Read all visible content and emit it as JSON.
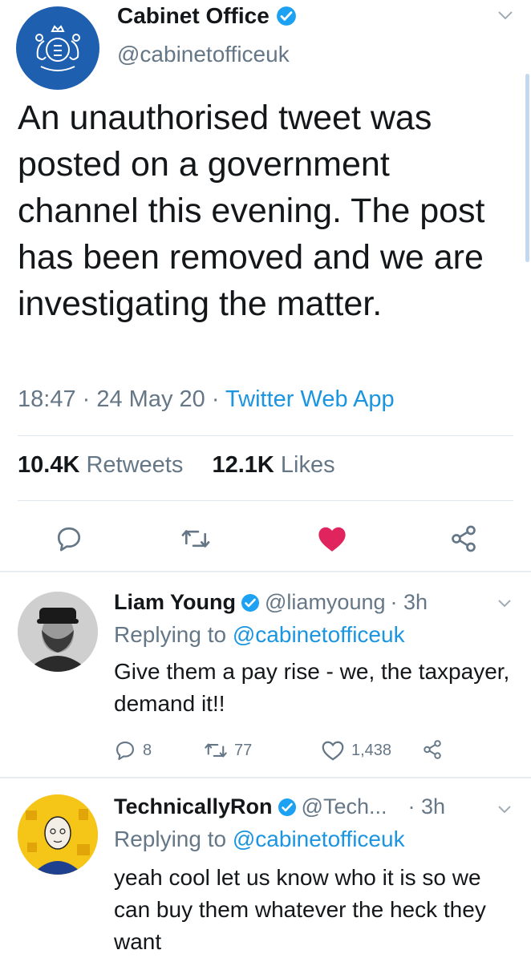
{
  "main": {
    "name": "Cabinet Office",
    "handle": "@cabinetofficeuk",
    "text": "An unauthorised tweet was posted on a government channel this evening. The post has been removed and we are investigating the matter.",
    "time": "18:47",
    "date": "24 May 20",
    "source": "Twitter Web App",
    "retweets_count": "10.4K",
    "retweets_label": "Retweets",
    "likes_count": "12.1K",
    "likes_label": "Likes"
  },
  "replies": [
    {
      "name": "Liam Young",
      "handle": "@liamyoung",
      "time": "· 3h",
      "replying_prefix": "Replying to ",
      "replying_to": "@cabinetofficeuk",
      "text": "Give them a pay rise - we, the taxpayer, demand it!!",
      "reply_count": "8",
      "retweet_count": "77",
      "like_count": "1,438"
    },
    {
      "name": "TechnicallyRon",
      "handle": "@Tech...",
      "time": "· 3h",
      "replying_prefix": "Replying to ",
      "replying_to": "@cabinetofficeuk",
      "text": "yeah cool let us know who it is so we can buy them whatever the heck they want"
    }
  ],
  "colors": {
    "accent": "#1b95e0",
    "like": "#e0245e",
    "secondary": "#657786",
    "org_blue": "#1e5fb0"
  },
  "icons": [
    "verified-badge-icon",
    "chevron-down-icon",
    "reply-icon",
    "retweet-icon",
    "heart-filled-icon",
    "heart-icon",
    "share-icon"
  ]
}
